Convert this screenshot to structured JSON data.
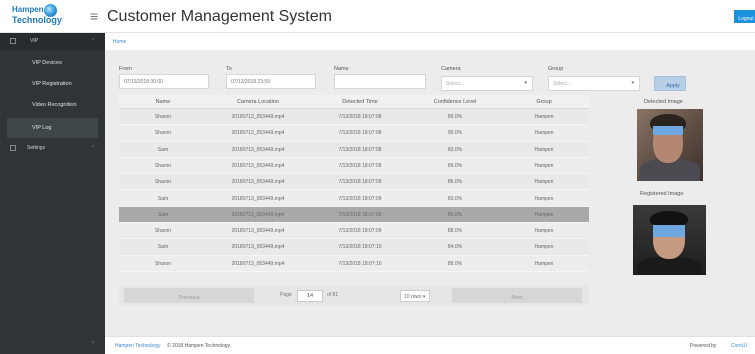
{
  "header": {
    "logo_line1": "Hampen",
    "logo_line2": "Technology",
    "menu_icon": "hamburger-icon",
    "title": "Customer Management System",
    "logout_label": "Logout",
    "accent": "#1c91de"
  },
  "sidebar": {
    "section": "VIP",
    "items": [
      "VIP Devices",
      "VIP Registration",
      "Video Recognition",
      "VIP Log"
    ],
    "active_item": "VIP Log",
    "settings": "Settings",
    "collapse_icon": "chevron-left-icon"
  },
  "breadcrumb": "Home",
  "filters": {
    "from_label": "From",
    "from_value": "07/13/2018 00:00",
    "to_label": "To",
    "to_value": "07/13/2018 23:59",
    "name_label": "Name",
    "name_value": "",
    "camera_label": "Camera",
    "camera_placeholder": "Select...",
    "group_label": "Group",
    "group_placeholder": "Select...",
    "apply_label": "Apply"
  },
  "table": {
    "columns": [
      "Name",
      "Camera Location",
      "Detected Time",
      "Confidence Level",
      "Group"
    ],
    "rows": [
      [
        "Sharon",
        "20180713_053449.mp4",
        "7/13/2018 18:07:08",
        "89.0%",
        "Hampen"
      ],
      [
        "Sharon",
        "20180713_053449.mp4",
        "7/13/2018 18:07:08",
        "90.0%",
        "Hampen"
      ],
      [
        "Sam",
        "20180713_053449.mp4",
        "7/13/2018 18:07:08",
        "83.0%",
        "Hampen"
      ],
      [
        "Sharon",
        "20180713_053449.mp4",
        "7/13/2018 18:07:09",
        "89.0%",
        "Hampen"
      ],
      [
        "Sharon",
        "20180713_053449.mp4",
        "7/13/2018 18:07:09",
        "86.0%",
        "Hampen"
      ],
      [
        "Sam",
        "20180713_053449.mp4",
        "7/13/2018 18:07:09",
        "83.0%",
        "Hampen"
      ],
      [
        "Sam",
        "20180713_053449.mp4",
        "7/13/2018 18:07:09",
        "85.0%",
        "Hampen"
      ],
      [
        "Sharon",
        "20180713_053449.mp4",
        "7/13/2018 18:07:09",
        "88.0%",
        "Hampen"
      ],
      [
        "Sam",
        "20180713_053449.mp4",
        "7/13/2018 18:07:10",
        "84.0%",
        "Hampen"
      ],
      [
        "Sharon",
        "20180713_053449.mp4",
        "7/13/2018 18:07:10",
        "89.0%",
        "Hampen"
      ]
    ],
    "selected_row": 6
  },
  "pagination": {
    "prev_label": "Previous",
    "page_label": "Page",
    "page_value": "14",
    "of_label": "of 81",
    "rows_label": "10 rows",
    "next_label": "Next"
  },
  "images": {
    "detected_title": "Detected Image",
    "registered_title": "Registered Image"
  },
  "footer": {
    "link": "Hampen Technology",
    "copyright": "© 2018 Hampen Technology.",
    "powered": "Powered by",
    "brand": "CoreUI"
  }
}
